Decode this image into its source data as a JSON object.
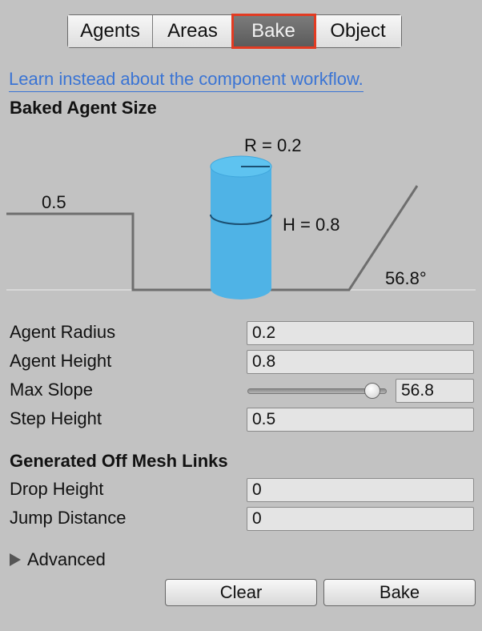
{
  "tabs": [
    "Agents",
    "Areas",
    "Bake",
    "Object"
  ],
  "active_tab": "Bake",
  "link_text": "Learn instead about the component workflow.",
  "baked_agent_size": {
    "heading": "Baked Agent Size",
    "diagram": {
      "radius_label": "R = 0.2",
      "height_label": "H = 0.8",
      "step_label": "0.5",
      "slope_label": "56.8°"
    }
  },
  "fields": {
    "agent_radius": {
      "label": "Agent Radius",
      "value": "0.2"
    },
    "agent_height": {
      "label": "Agent Height",
      "value": "0.8"
    },
    "max_slope": {
      "label": "Max Slope",
      "value": "56.8",
      "slider_fraction": 0.947
    },
    "step_height": {
      "label": "Step Height",
      "value": "0.5"
    }
  },
  "off_mesh": {
    "heading": "Generated Off Mesh Links",
    "drop_height": {
      "label": "Drop Height",
      "value": "0"
    },
    "jump_distance": {
      "label": "Jump Distance",
      "value": "0"
    }
  },
  "advanced_label": "Advanced",
  "buttons": {
    "clear": "Clear",
    "bake": "Bake"
  },
  "colors": {
    "accent_highlight": "#e23b22",
    "link": "#3a74d4",
    "cylinder": "#4fb3e6",
    "background": "#c2c2c2"
  }
}
